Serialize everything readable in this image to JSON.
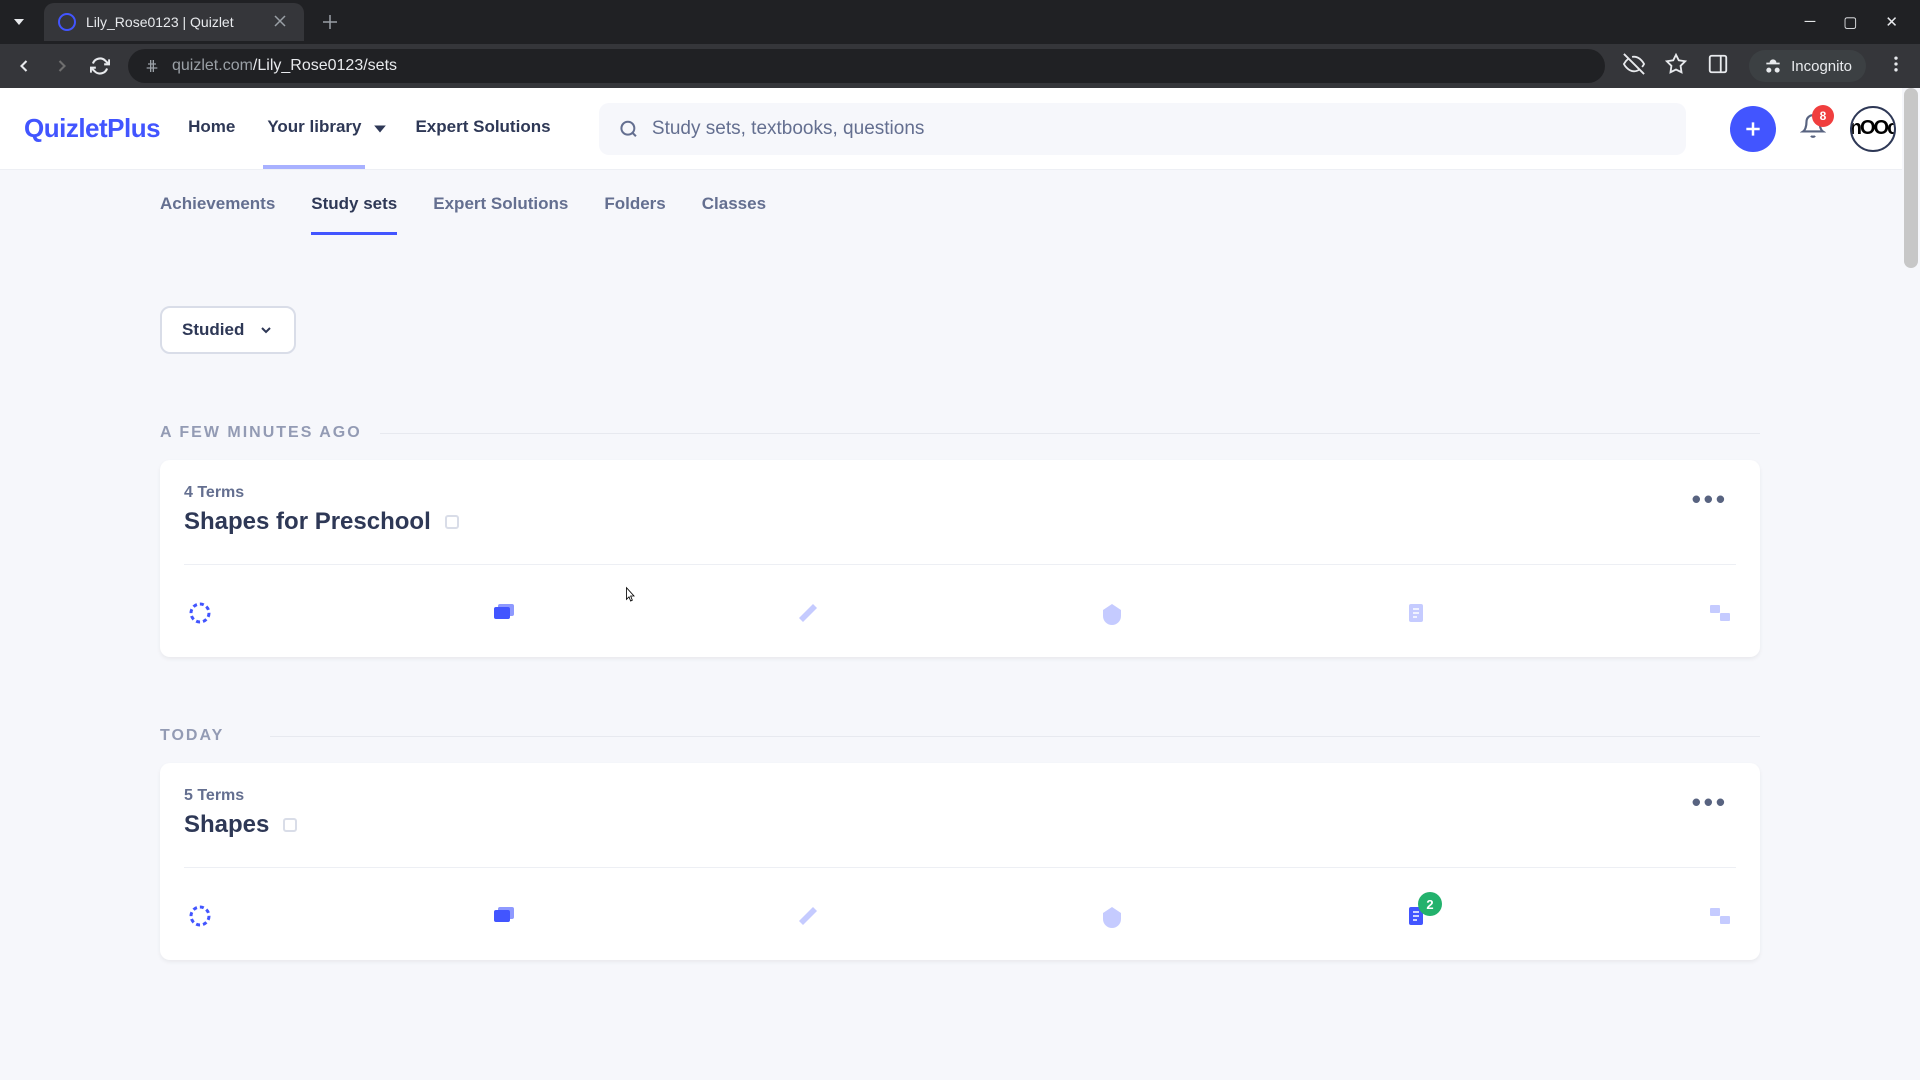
{
  "browser": {
    "tab_title": "Lily_Rose0123 | Quizlet",
    "url_host": "quizlet.com",
    "url_path": "/Lily_Rose0123/sets",
    "incognito_label": "Incognito"
  },
  "header": {
    "logo": "QuizletPlus",
    "nav_home": "Home",
    "nav_library": "Your library",
    "nav_expert": "Expert Solutions",
    "search_placeholder": "Study sets, textbooks, questions",
    "notif_count": "8",
    "avatar_text": "nOOc"
  },
  "subnav": {
    "achievements": "Achievements",
    "study_sets": "Study sets",
    "expert_solutions": "Expert Solutions",
    "folders": "Folders",
    "classes": "Classes"
  },
  "filter_label": "Studied",
  "sections": [
    {
      "heading": "A FEW MINUTES AGO",
      "terms": "4 Terms",
      "title": "Shapes for Preschool",
      "actions": [
        {
          "icon": "learn",
          "dim": false,
          "badge": null
        },
        {
          "icon": "flashcards",
          "dim": false,
          "badge": null
        },
        {
          "icon": "write",
          "dim": true,
          "badge": null
        },
        {
          "icon": "spell",
          "dim": true,
          "badge": null
        },
        {
          "icon": "test",
          "dim": true,
          "badge": null
        },
        {
          "icon": "match",
          "dim": true,
          "badge": null
        }
      ]
    },
    {
      "heading": "TODAY",
      "terms": "5 Terms",
      "title": "Shapes",
      "actions": [
        {
          "icon": "learn",
          "dim": false,
          "badge": null
        },
        {
          "icon": "flashcards",
          "dim": false,
          "badge": null
        },
        {
          "icon": "write",
          "dim": true,
          "badge": null
        },
        {
          "icon": "spell",
          "dim": true,
          "badge": null
        },
        {
          "icon": "test",
          "dim": false,
          "badge": "2"
        },
        {
          "icon": "match",
          "dim": true,
          "badge": null
        }
      ]
    }
  ]
}
